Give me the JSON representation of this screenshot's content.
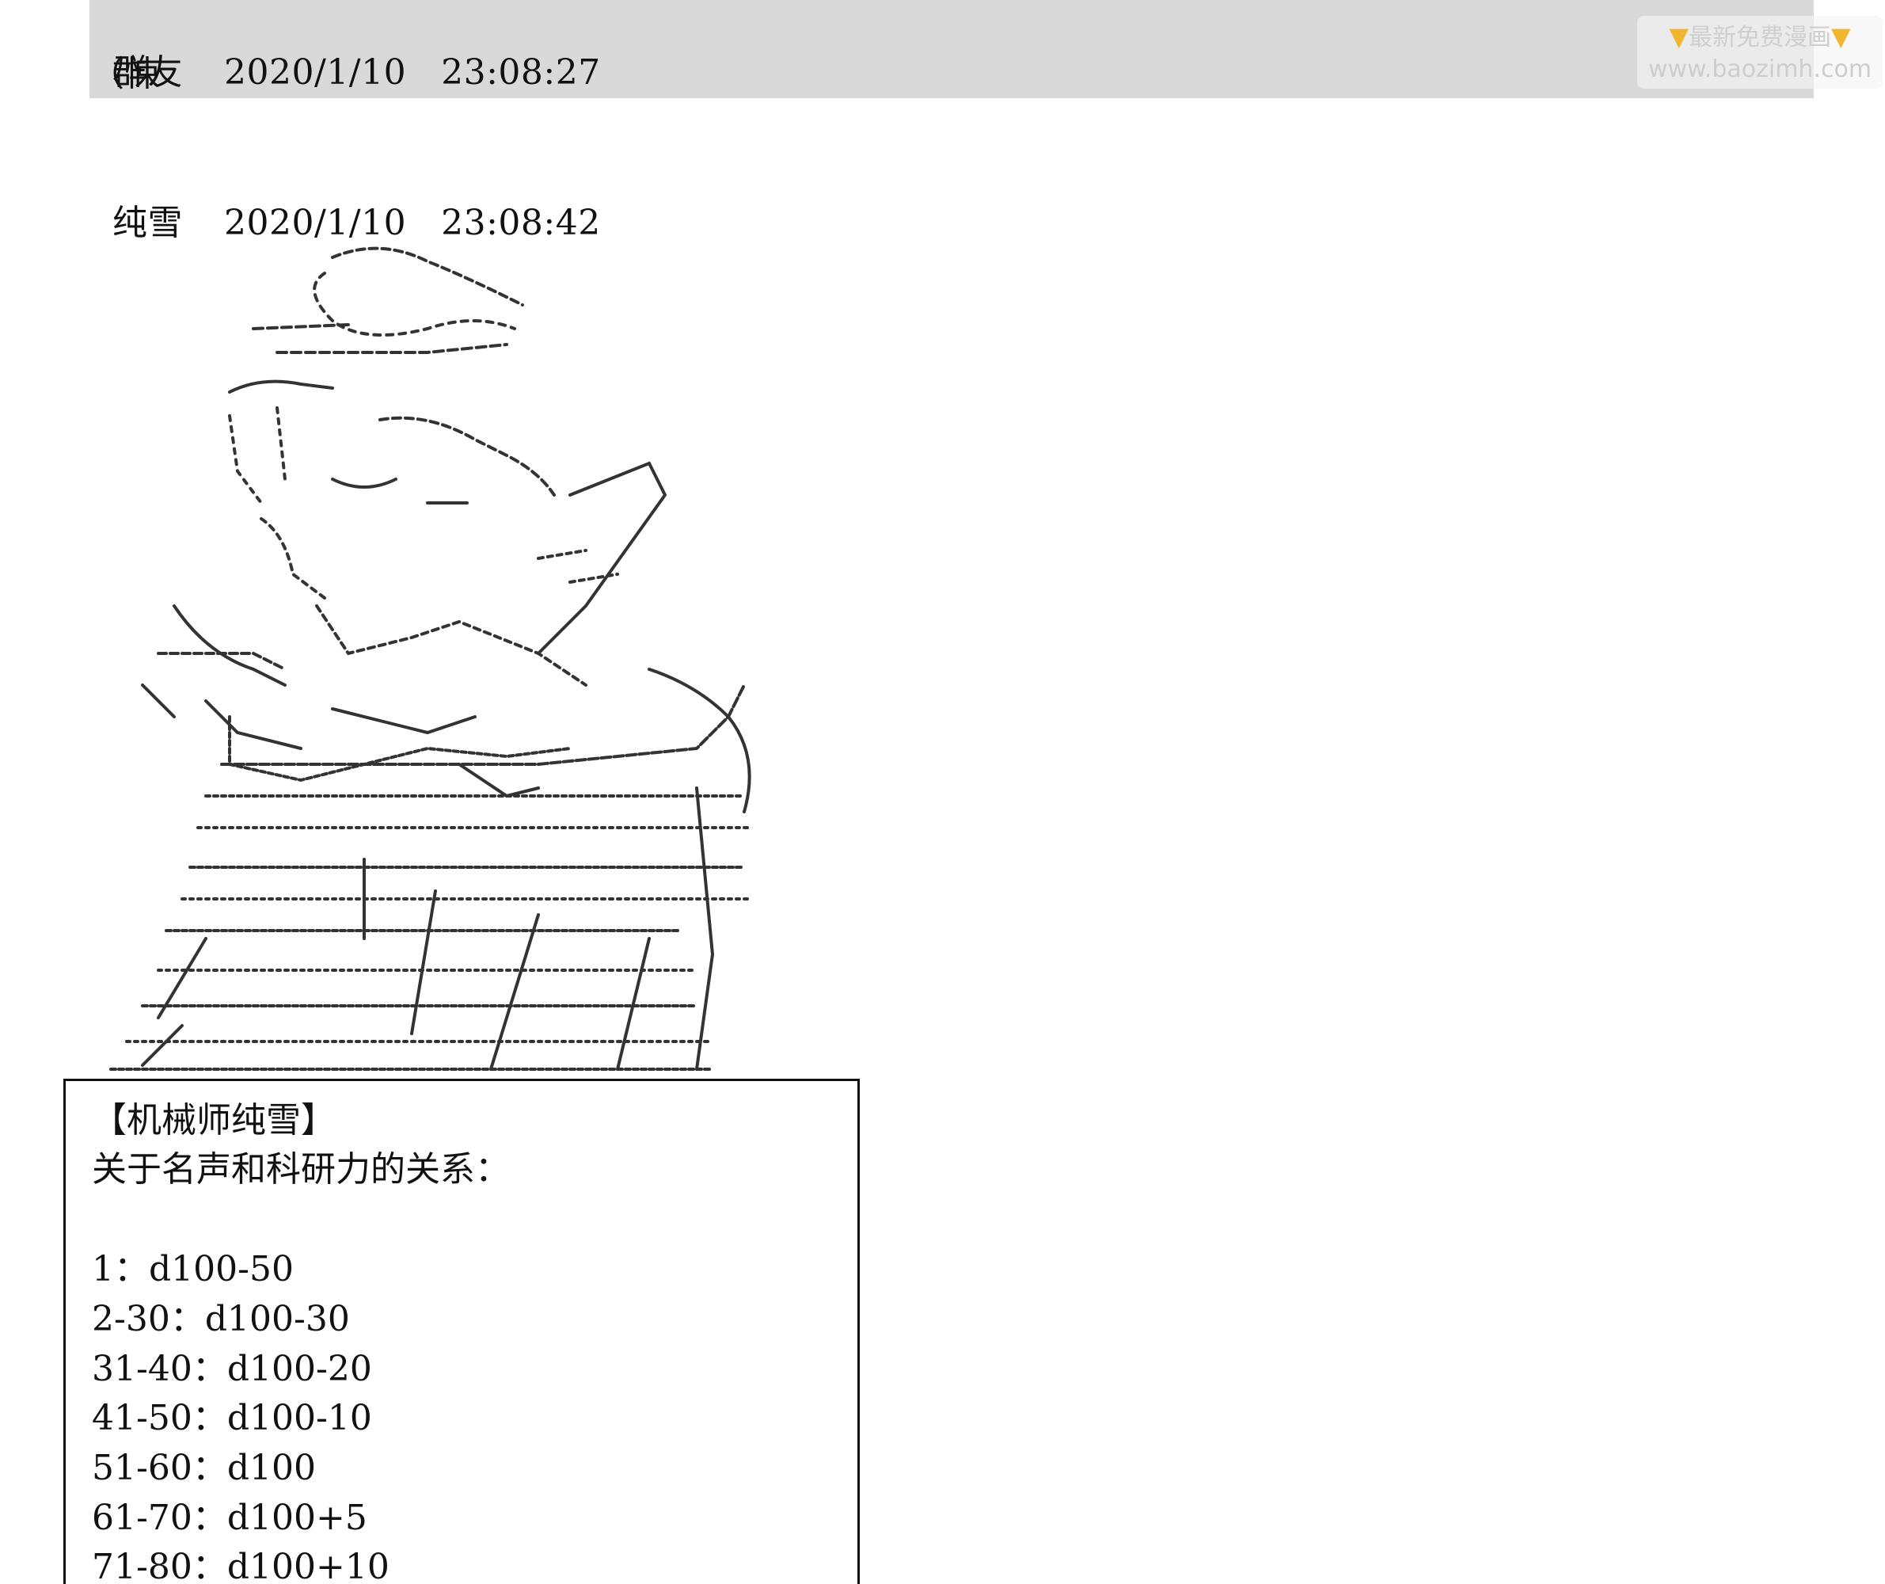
{
  "messages": [
    {
      "author": "群友",
      "date": "2020/1/10",
      "time": "23:08:27",
      "text": "（悚"
    },
    {
      "author": "纯雪",
      "date": "2020/1/10",
      "time": "23:08:42"
    }
  ],
  "watermark": {
    "line1": "最新免费漫画",
    "hand_icon": "pointing-down-hand-icon",
    "url": "www.baozimh.com",
    "accent_color": "#f2b530"
  },
  "box": {
    "title": "【机械师纯雪】",
    "subtitle": "关于名声和科研力的关系：",
    "rules": [
      "1：d100-50",
      "2-30：d100-30",
      "31-40：d100-20",
      "41-50：d100-10",
      "51-60：d100",
      "61-70：d100+5",
      "71-80：d100+10"
    ]
  },
  "colors": {
    "highlight_bg": "#d9d9d9",
    "text": "#111111",
    "border": "#111111"
  }
}
